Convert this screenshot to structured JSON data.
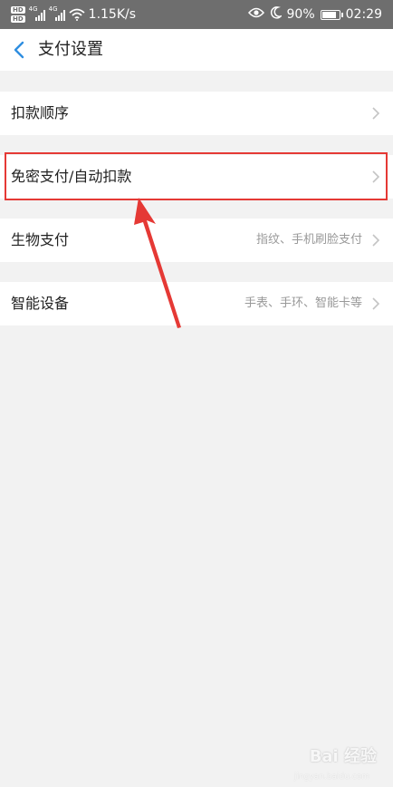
{
  "status_bar": {
    "hd_badge_1": "HD",
    "hd_badge_2": "HD",
    "signal_1_label": "4G",
    "signal_2_label": "4G",
    "speed": "1.15K/s",
    "battery_percent": "90%",
    "battery_level": 0.9,
    "time": "02:29",
    "icons": [
      "hd-icon",
      "signal-icon",
      "wifi-icon",
      "eye-icon",
      "moon-icon",
      "battery-icon"
    ]
  },
  "header": {
    "title": "支付设置"
  },
  "rows": [
    {
      "label": "扣款顺序",
      "value": ""
    },
    {
      "label": "免密支付/自动扣款",
      "value": ""
    },
    {
      "label": "生物支付",
      "value": "指纹、手机刷脸支付"
    },
    {
      "label": "智能设备",
      "value": "手表、手环、智能卡等"
    }
  ],
  "annotation": {
    "highlight_color": "#e53935"
  },
  "watermark": {
    "text": "Bai 经验",
    "sub": "jingyan.baidu.com"
  },
  "colors": {
    "status_bar_bg": "#6e6e6e",
    "page_bg": "#f2f2f2",
    "back_icon": "#2f8ee0"
  }
}
